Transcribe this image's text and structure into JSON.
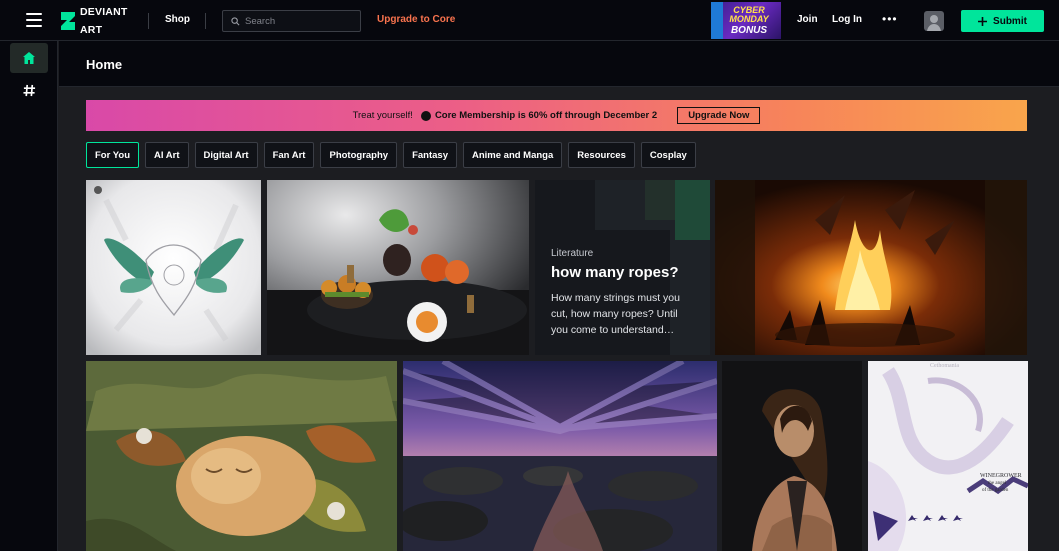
{
  "header": {
    "logo_line1": "DEVIANT",
    "logo_line2": "ART",
    "shop": "Shop",
    "search_placeholder": "Search",
    "upgrade": "Upgrade to Core",
    "promo_badge": {
      "line1": "CYBER",
      "line2": "MONDAY",
      "line3": "BONUS"
    },
    "join": "Join",
    "login": "Log In",
    "more": "•••",
    "submit": "Submit"
  },
  "page": {
    "title": "Home"
  },
  "banner": {
    "treat": "Treat yourself!",
    "offer": "Core Membership is 60% off through December 2",
    "button": "Upgrade Now"
  },
  "chips": [
    "For You",
    "AI Art",
    "Digital Art",
    "Fan Art",
    "Photography",
    "Fantasy",
    "Anime and Manga",
    "Resources",
    "Cosplay"
  ],
  "active_chip": "For You",
  "literature": {
    "category": "Literature",
    "title": "how many ropes?",
    "excerpt": "How many strings must you cut, how many ropes? Until you come to understand…"
  },
  "poster_text": {
    "top": "Cethomania",
    "title": "WINEGROWER",
    "line2": "the angel",
    "line3": "of the garden"
  },
  "colors": {
    "accent": "#00e59b",
    "upgrade": "#f9734e",
    "background": "#1c1d21",
    "nav": "#06070d"
  }
}
